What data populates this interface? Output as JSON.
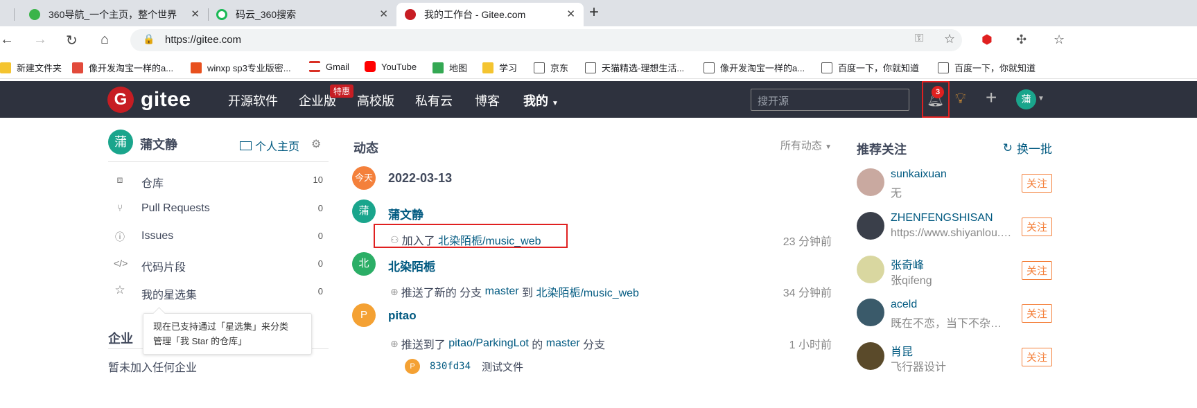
{
  "browser": {
    "tabs": [
      {
        "title": "360导航_一个主页，整个世界",
        "favicon_color": "#3bb44a"
      },
      {
        "title": "码云_360搜索",
        "favicon_color": "#19b955"
      },
      {
        "title": "我的工作台 - Gitee.com",
        "favicon_color": "#c71d23"
      }
    ],
    "url": "https://gitee.com",
    "bookmarks": [
      {
        "label": "新建文件夹",
        "icon_color": "#f4c430"
      },
      {
        "label": "像开发淘宝一样的a...",
        "icon_color": "#e24a3b"
      },
      {
        "label": "winxp sp3专业版密...",
        "icon_color": "#e8501e"
      },
      {
        "label": "Gmail",
        "icon_color": "#d93025"
      },
      {
        "label": "YouTube",
        "icon_color": "#ff0000"
      },
      {
        "label": "地图",
        "icon_color": "#34a853"
      },
      {
        "label": "学习",
        "icon_color": "#f4c430"
      },
      {
        "label": "京东",
        "icon_color": "#ffffff"
      },
      {
        "label": "天猫精选-理想生活...",
        "icon_color": "#ffffff"
      },
      {
        "label": "像开发淘宝一样的a...",
        "icon_color": "#ffffff"
      },
      {
        "label": "百度一下，你就知道",
        "icon_color": "#ffffff"
      },
      {
        "label": "百度一下，你就知道",
        "icon_color": "#ffffff"
      }
    ]
  },
  "header": {
    "logo_text": "gitee",
    "logo_mark": "G",
    "nav": [
      "开源软件",
      "企业版",
      "高校版",
      "私有云",
      "博客",
      "我的"
    ],
    "promo_badge": "特惠",
    "search_placeholder": "搜开源",
    "notification_count": "3",
    "user_initial": "蒲"
  },
  "sidebar": {
    "user_initial": "蒲",
    "user_name": "蒲文静",
    "homepage_label": "个人主页",
    "items": [
      {
        "label": "仓库",
        "count": "10",
        "icon": "repo-icon"
      },
      {
        "label": "Pull Requests",
        "count": "0",
        "icon": "pull-request-icon"
      },
      {
        "label": "Issues",
        "count": "0",
        "icon": "issue-icon"
      },
      {
        "label": "代码片段",
        "count": "0",
        "icon": "code-icon"
      },
      {
        "label": "我的星选集",
        "count": "0",
        "icon": "star-icon"
      }
    ],
    "tooltip_line1": "现在已支持通过「星选集」来分类",
    "tooltip_line2": "管理「我 Star 的仓库」",
    "enterprise_title": "企业",
    "enterprise_none": "暂未加入任何企业"
  },
  "feed": {
    "title": "动态",
    "filter": "所有动态",
    "today_label": "今天",
    "date": "2022-03-13",
    "events": [
      {
        "initial": "蒲",
        "actor": "蒲文静",
        "color": "#1aa58c",
        "verb": "加入了",
        "repo": "北染陌栀/music_web",
        "time": "23 分钟前"
      },
      {
        "initial": "北",
        "actor": "北染陌栀",
        "color": "#2bae66",
        "verb": "推送了新的 分支",
        "branch": "master",
        "mid": "到",
        "repo": "北染陌栀/music_web",
        "time": "34 分钟前"
      },
      {
        "initial": "P",
        "actor": "pitao",
        "color": "#f4a133",
        "verb": "推送到了",
        "repo": "pitao/ParkingLot",
        "mid": "的",
        "branch": "master",
        "tail": "分支",
        "time": "1 小时前"
      }
    ],
    "commit": {
      "avatar": "P",
      "sha": "830fd34",
      "message": "测试文件"
    }
  },
  "recommend": {
    "title": "推荐关注",
    "refresh_label": "换一批",
    "follow_label": "关注",
    "users": [
      {
        "name": "sunkaixuan",
        "desc": "无",
        "avatar_color": "#c9a9a0"
      },
      {
        "name": "ZHENFENGSHISAN",
        "desc": "https://www.shiyanlou.com",
        "avatar_color": "#3a3f4a"
      },
      {
        "name": "张奇峰",
        "desc": "张qifeng",
        "avatar_color": "#d9d7a0"
      },
      {
        "name": "aceld",
        "desc": "既在不恋，当下不杂，未来不迎",
        "avatar_color": "#3a5a6a"
      },
      {
        "name": "肖昆",
        "desc": "飞行器设计",
        "avatar_color": "#5a4a2a"
      }
    ]
  }
}
